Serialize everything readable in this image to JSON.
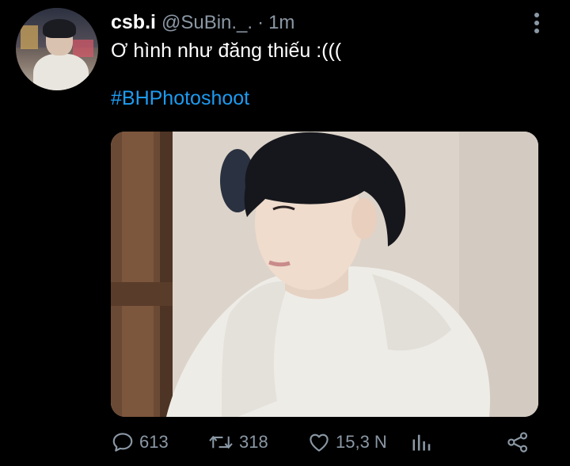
{
  "user": {
    "display_name": "csb.i",
    "handle": "@SuBin._.",
    "separator": "·",
    "time": "1m"
  },
  "tweet": {
    "text": "Ơ hình như đăng thiếu :(((",
    "hashtag": "#BHPhotoshoot"
  },
  "actions": {
    "reply_count": "613",
    "retweet_count": "318",
    "like_count": "15,3 N"
  },
  "icons": {
    "more": "more-vertical-icon",
    "reply": "reply-bubble-icon",
    "retweet": "retweet-icon",
    "like": "heart-icon",
    "analytics": "analytics-bars-icon",
    "share": "share-icon"
  },
  "colors": {
    "background": "#000000",
    "text": "#ffffff",
    "secondary": "#8b98a5",
    "link": "#1d9bf0"
  }
}
